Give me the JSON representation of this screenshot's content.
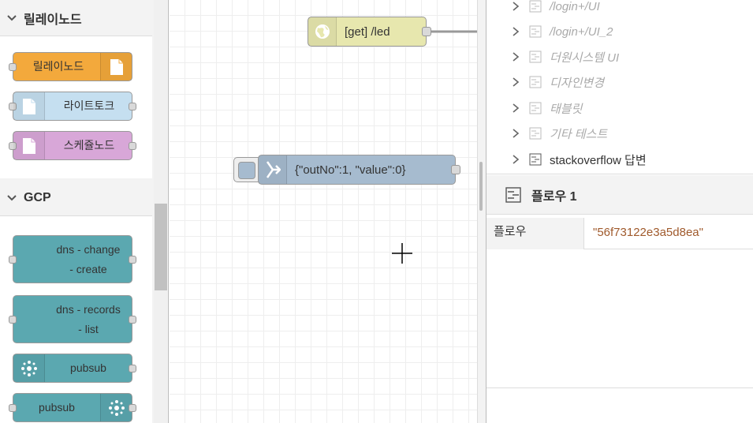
{
  "palette": {
    "categories": [
      {
        "name": "릴레이노드",
        "nodes": [
          {
            "label": "릴레이노드",
            "color": "#f3a93c",
            "icon": "file-icon",
            "icon_side": "right"
          },
          {
            "label": "라이트토크",
            "color": "#c5dff0",
            "icon": "file-icon",
            "icon_side": "left"
          },
          {
            "label": "스케쥴노드",
            "color": "#d8a7d8",
            "icon": "file-icon",
            "icon_side": "left"
          }
        ]
      },
      {
        "name": "GCP",
        "nodes": [
          {
            "label_lines": [
              "dns - change",
              "- create"
            ],
            "color": "#5ba8b0"
          },
          {
            "label_lines": [
              "dns - records",
              "- list"
            ],
            "color": "#5ba8b0"
          },
          {
            "label": "pubsub",
            "color": "#5ba8b0",
            "icon": "pubsub-icon",
            "icon_side": "left"
          },
          {
            "label": "pubsub",
            "color": "#5ba8b0",
            "icon": "pubsub-icon",
            "icon_side": "right"
          }
        ]
      }
    ]
  },
  "workspace": {
    "nodes": [
      {
        "label": "[get] /led",
        "color": "#e7e7ae",
        "icon": "globe-icon",
        "type": "http-in"
      },
      {
        "label": "{\"outNo\":1, \"value\":0}",
        "color": "#a6bbcf",
        "icon": "inject-icon",
        "type": "inject"
      }
    ]
  },
  "sidebar": {
    "flows": [
      {
        "label": "/login+/UI",
        "disabled": true
      },
      {
        "label": "/login+/UI_2",
        "disabled": true
      },
      {
        "label": "더원시스템 UI",
        "disabled": true
      },
      {
        "label": "디자인변경",
        "disabled": true
      },
      {
        "label": "태블릿",
        "disabled": true
      },
      {
        "label": "기타 테스트",
        "disabled": true
      },
      {
        "label": "stackoverflow 답변",
        "disabled": false
      }
    ],
    "info": {
      "title": "플로우 1",
      "property_key": "플로우",
      "property_value": "\"56f73122e3a5d8ea\""
    }
  }
}
